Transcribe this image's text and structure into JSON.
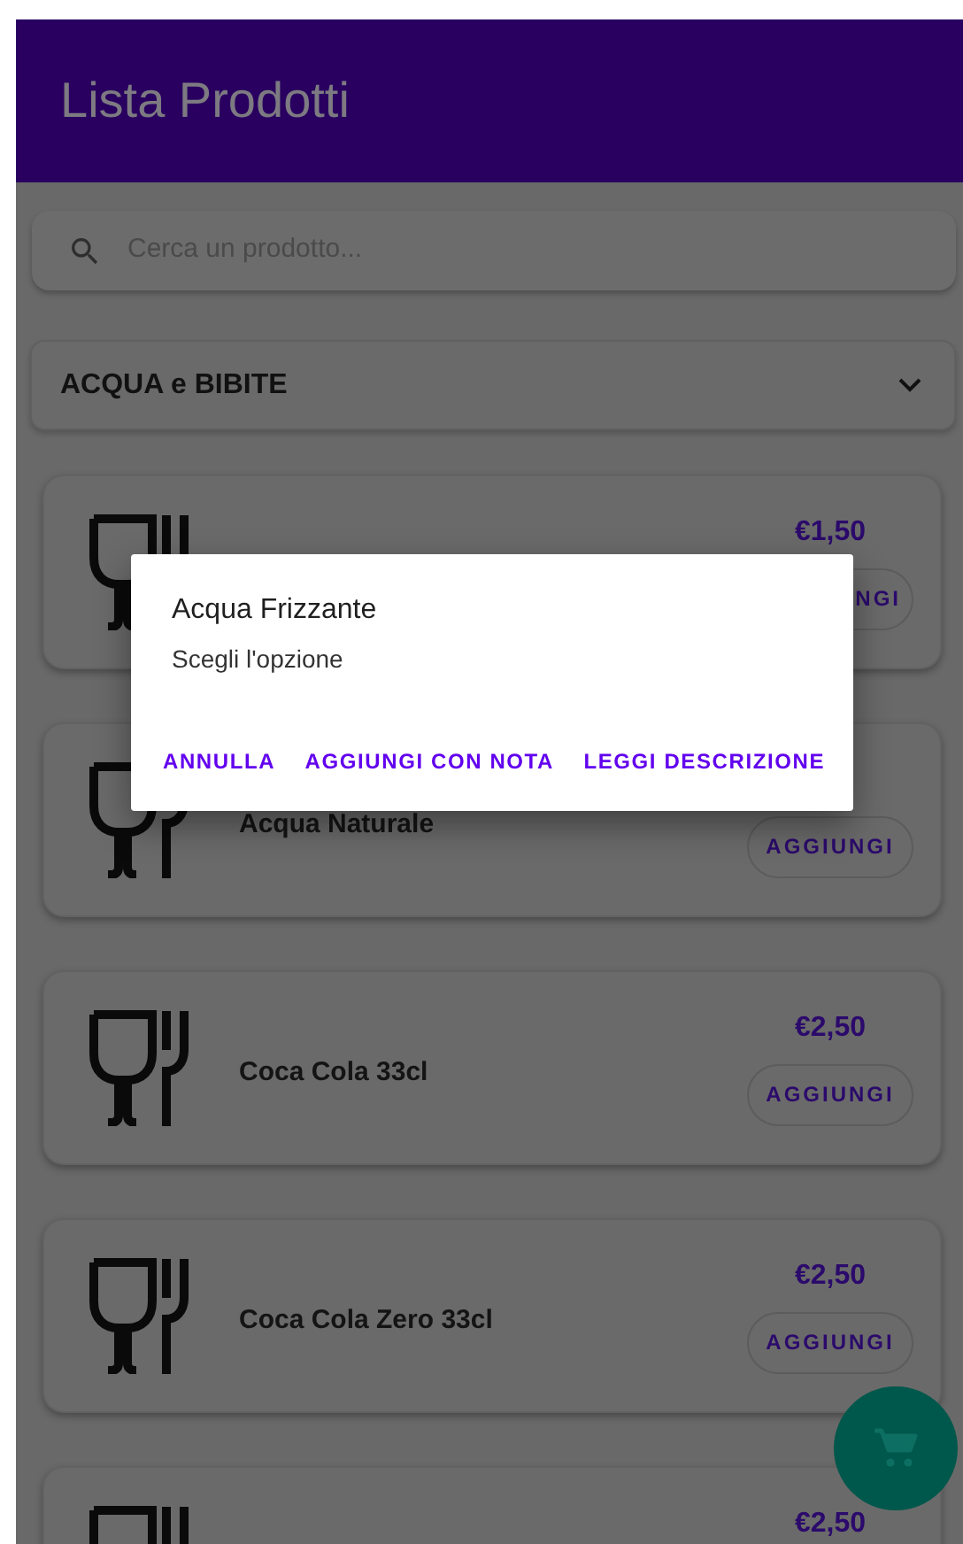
{
  "app_bar": {
    "title": "Lista Prodotti"
  },
  "search": {
    "placeholder": "Cerca un prodotto..."
  },
  "category_dropdown": {
    "value": "ACQUA e BIBITE",
    "expanded": false
  },
  "products": [
    {
      "price": "€1,50",
      "button": "NGI",
      "button_cut_left": true
    },
    {
      "name": "Acqua Naturale",
      "button": "AGGIUNGI"
    },
    {
      "name": "Coca Cola 33cl",
      "price": "€2,50",
      "button": "AGGIUNGI"
    },
    {
      "name": "Coca Cola Zero 33cl",
      "price": "€2,50",
      "button": "AGGIUNGI"
    },
    {
      "price": "€2,50"
    }
  ],
  "dialog": {
    "title": "Acqua Frizzante",
    "message": "Scegli l'opzione",
    "actions": [
      "ANNULLA",
      "AGGIUNGI CON NOTA",
      "LEGGI DESCRIZIONE"
    ]
  }
}
